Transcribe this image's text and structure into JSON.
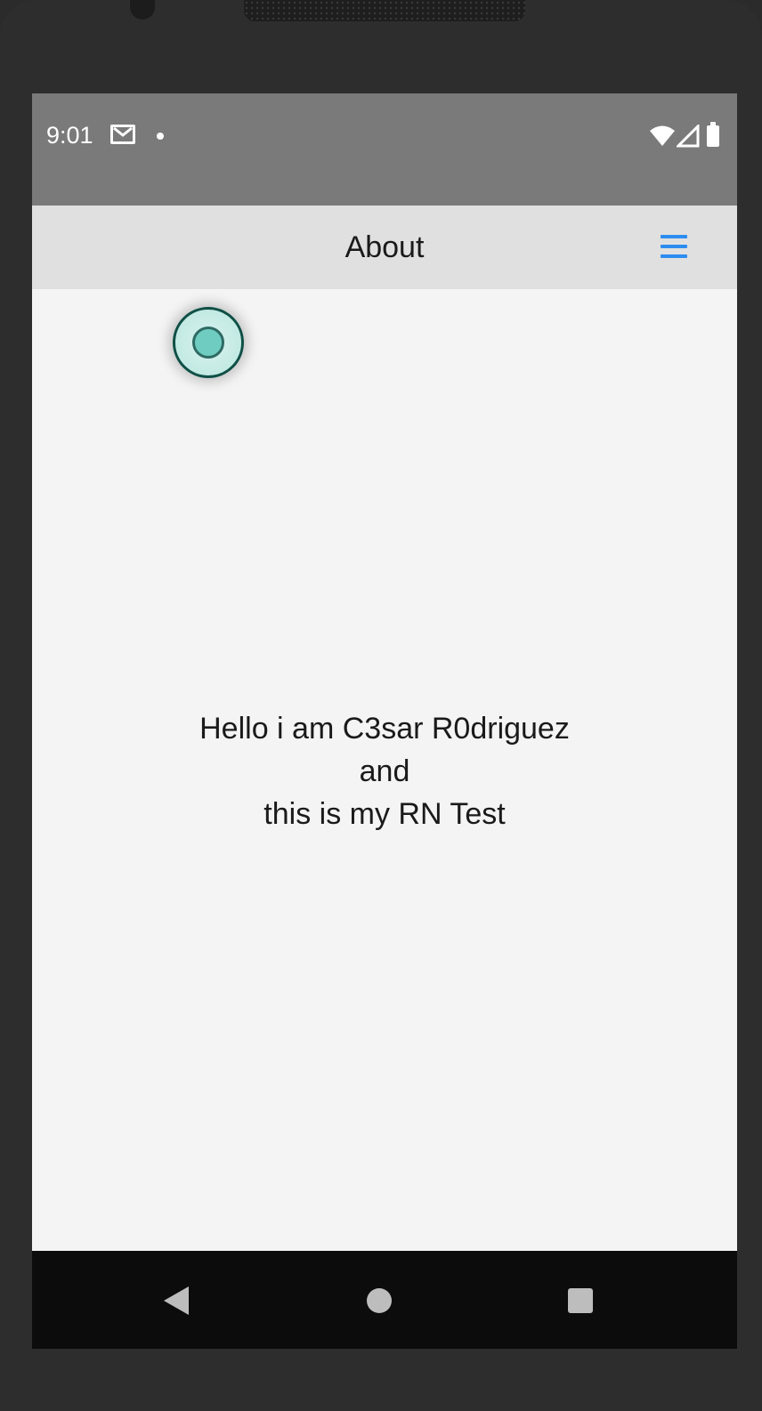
{
  "status_bar": {
    "time": "9:01",
    "icons": [
      "gmail-icon",
      "notification-dot-icon",
      "wifi-icon",
      "signal-icon",
      "battery-icon"
    ]
  },
  "header": {
    "title": "About",
    "menu_icon": "hamburger-menu-icon",
    "menu_color": "#2d8cf0"
  },
  "floating_button": {
    "icon": "radio-circle-icon",
    "accent": "#6ecdc0"
  },
  "content": {
    "lines": [
      "Hello i am C3sar R0driguez",
      "and",
      "this is my RN Test"
    ]
  },
  "nav_bar": {
    "buttons": [
      "back-icon",
      "home-icon",
      "recents-icon"
    ]
  },
  "colors": {
    "status_bar": "#7a7a7a",
    "header": "#e0e0e0",
    "screen": "#f4f4f4",
    "nav_bar": "#0c0c0c"
  }
}
